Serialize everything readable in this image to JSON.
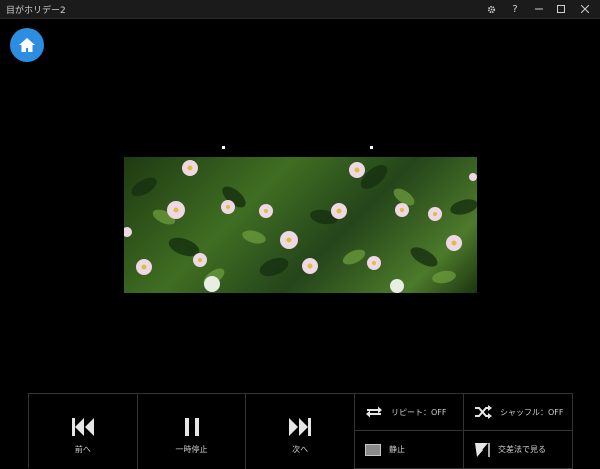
{
  "app": {
    "title": "目がホリデー2"
  },
  "titlebar": {
    "settings_icon": "gear-icon",
    "help_label": "?",
    "minimize_icon": "minimize-icon",
    "maximize_icon": "maximize-icon",
    "close_icon": "close-icon"
  },
  "home": {
    "icon": "home-icon"
  },
  "controls": {
    "prev_label": "前へ",
    "pause_label": "一時停止",
    "next_label": "次へ",
    "repeat_label": "リピート：OFF",
    "shuffle_label": "シャッフル：OFF",
    "still_label": "静止",
    "crosseye_label": "交差法で見る"
  },
  "colors": {
    "accent": "#2d8de0",
    "background": "#000000",
    "titlebar": "#1b1b1b"
  }
}
